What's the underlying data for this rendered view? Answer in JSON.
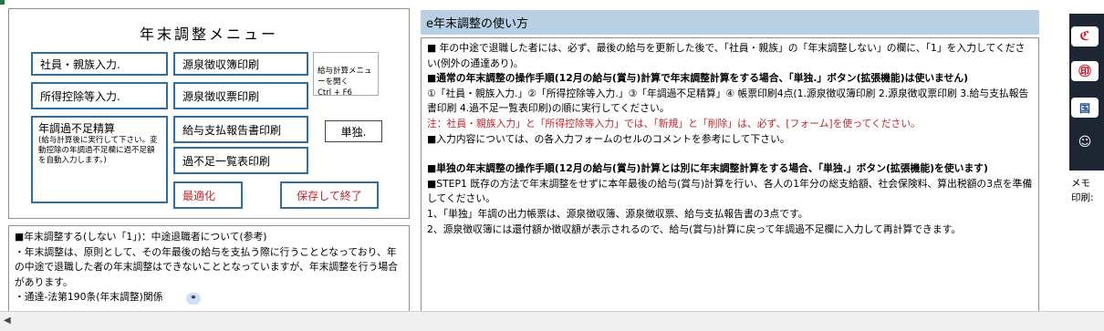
{
  "menu": {
    "title": "年末調整メニュー",
    "buttons": {
      "employee_input": "社員・親族入力.",
      "deduction_input": "所得控除等入力.",
      "adjust_calc": "年調過不足精算",
      "adjust_calc_note": "(給与計算後に実行して下さい。変動控除の年調過不足欄に過不足額を自動入力します。)",
      "withholding_book_print": "源泉徴収簿印刷",
      "withholding_slip_print": "源泉徴収票印刷",
      "payment_report_print": "給与支払報告書印刷",
      "deficit_list_print": "過不足一覧表印刷",
      "optimize": "最適化",
      "save_exit": "保存して終了",
      "standalone": "単独."
    },
    "salary_menu_note": "給与計算メニューを開く\nCtrl + F6"
  },
  "help": {
    "header": "e年末調整の使い方",
    "paragraphs": [
      "■ 年の中途で退職した者には、必ず、最後の給与を更新した後で、「社員・親族」の「年末調整しない」の欄に、「1」を入力してください(例外の通達あり)。",
      "■通常の年末調整の操作手順(12月の給与(賞与)計算で年末調整計算をする場合、「単独.」ボタン(拡張機能)は使いません)",
      "①「社員・親族入力.」②「所得控除等入力.」③「年調過不足精算」④ 帳票印刷4点(1.源泉徴収簿印刷 2.源泉徴収票印刷 3.給与支払報告書印刷 4.過不足一覧表印刷)の順に実行してください。",
      "注：社員・親族入力」と「所得控除等入力」では、「新規」と「削除」は、必ず、[フォーム]を使ってください。",
      "■入力内容については、の各入力フォームのセルのコメントを参考にして下さい。",
      "■単独の年末調整の操作手順(12月の給与(賞与)計算とは別に年末調整計算をする場合、「単独.」ボタン(拡張機能)を使います)",
      "■STEP1 既存の方法で年末調整をせずに本年最後の給与(賞与)計算を行い、各人の1年分の総支給額、社会保険料、算出税額の3点を準備してください。",
      "1、「単独」年調の出力帳票は、源泉徴収簿、源泉徴収票、給与支払報告書の3点です。",
      "2、源泉徴収簿には還付額か徴収額が表示されるので、給与(賞与)計算に戻って年調過不足欄に入力して再計算できます。"
    ]
  },
  "note": {
    "lines": [
      "■年末調整する(しない「1」)：中途退職者について(参考)",
      "・年末調整は、原則として、その年最後の給与を支払う際に行うこととなっており、年の中途で退職した者の年末調整はできないこととなっていますが、年末調整を行う場合があります。",
      "・通達-法第190条(年末調整)関係"
    ]
  },
  "side": {
    "memo_label": "メモ",
    "print_label": "印刷:"
  },
  "colors": {
    "header_bg": "#b8cfe4",
    "button_border": "#2e6fa3",
    "accent_red": "#c0262d"
  }
}
